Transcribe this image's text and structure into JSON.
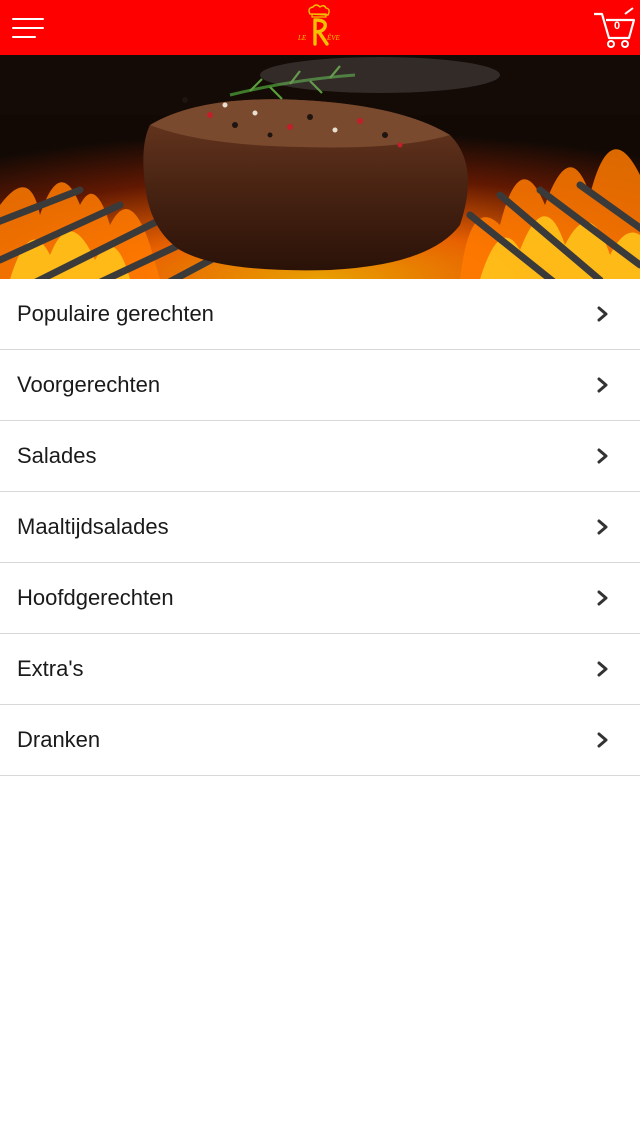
{
  "header": {
    "menu_icon": "hamburger-menu-icon",
    "logo_text": "LE RÊVE",
    "cart_icon": "shopping-cart-icon",
    "cart_count": "0",
    "colors": {
      "header_bg": "#ff0000",
      "icon": "#ffffff",
      "logo_yellow": "#f2c200"
    }
  },
  "hero": {
    "image": "steak-on-flaming-grill"
  },
  "categories": [
    {
      "label": "Populaire gerechten"
    },
    {
      "label": "Voorgerechten"
    },
    {
      "label": "Salades"
    },
    {
      "label": "Maaltijdsalades"
    },
    {
      "label": "Hoofdgerechten"
    },
    {
      "label": "Extra's"
    },
    {
      "label": "Dranken"
    }
  ],
  "chevron_icon": "chevron-right-icon"
}
